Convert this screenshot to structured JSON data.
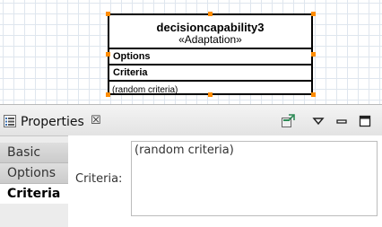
{
  "diagram": {
    "node": {
      "name": "decisioncapability3",
      "stereotype": "«Adaptation»",
      "options_label": "Options",
      "criteria_label": "Criteria",
      "criteria_value": "(random criteria)"
    }
  },
  "properties": {
    "title": "Properties",
    "close_glyph": "☒",
    "toolbar_icons": [
      "pin-icon",
      "view-menu-icon",
      "minimize-icon",
      "maximize-icon"
    ],
    "tabs": [
      {
        "label": "Basic"
      },
      {
        "label": "Options"
      },
      {
        "label": "Criteria",
        "active": true
      }
    ],
    "criteria_label": "Criteria:",
    "criteria_value": "(random criteria)"
  },
  "colors": {
    "selection_handle": "#ff8c00",
    "grid": "#dfe6ee"
  }
}
